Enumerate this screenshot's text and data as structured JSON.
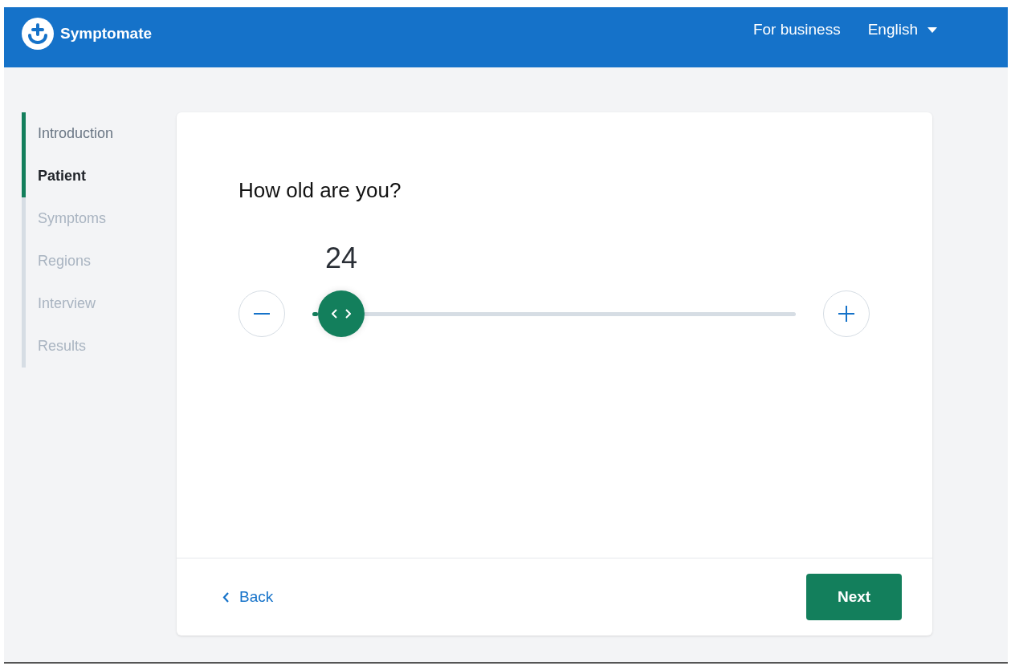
{
  "header": {
    "brand": "Symptomate",
    "links": [
      "For business"
    ],
    "language": "English"
  },
  "steps": [
    {
      "label": "Introduction",
      "completed": true,
      "selected": false
    },
    {
      "label": "Patient",
      "completed": true,
      "selected": true
    },
    {
      "label": "Symptoms",
      "completed": false,
      "selected": false
    },
    {
      "label": "Regions",
      "completed": false,
      "selected": false
    },
    {
      "label": "Interview",
      "completed": false,
      "selected": false
    },
    {
      "label": "Results",
      "completed": false,
      "selected": false
    }
  ],
  "question": {
    "title": "How old are you?",
    "value": "24",
    "level": 0.06
  },
  "footer": {
    "back": "Back",
    "next": "Next"
  }
}
